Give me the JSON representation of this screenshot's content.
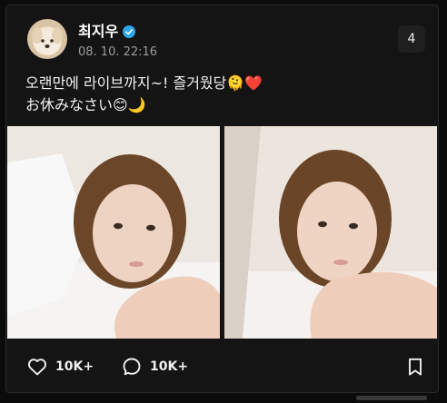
{
  "post": {
    "username": "최지우",
    "timestamp": "08. 10. 22:16",
    "image_count": "4",
    "text_lines": [
      "오랜만에 라이브까지~! 즐거웠당🫠❤️",
      "お休みなさい😊🌙"
    ],
    "actions": {
      "likes": "10K+",
      "comments": "10K+"
    },
    "icons": {
      "verified": "verified-badge-icon",
      "like": "heart-icon",
      "comment": "speech-bubble-icon",
      "save": "bookmark-icon"
    },
    "colors": {
      "background": "#0b0b0b",
      "card": "#141414",
      "verified": "#2fa6e6",
      "text_secondary": "#9c9c9c"
    }
  }
}
